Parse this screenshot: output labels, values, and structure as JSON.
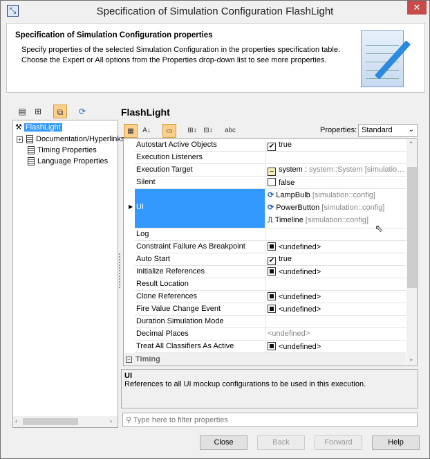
{
  "window": {
    "title": "Specification of Simulation Configuration FlashLight",
    "close": "✕"
  },
  "header": {
    "title": "Specification of Simulation Configuration properties",
    "desc_line1": "Specify properties of the selected Simulation Configuration in the properties specification table.",
    "desc_line2": "Choose the Expert or All options from the Properties drop-down list to see more properties."
  },
  "tree": {
    "root": "FlashLight",
    "items": [
      "Documentation/Hyperlinks",
      "Timing Properties",
      "Language Properties"
    ]
  },
  "panel": {
    "title": "FlashLight",
    "properties_label": "Properties:",
    "properties_value": "Standard"
  },
  "rows": [
    {
      "name": "Autostart Active Objects",
      "value": "true"
    },
    {
      "name": "Execution Listeners",
      "value": ""
    },
    {
      "name": "Execution Target",
      "value": "system :",
      "value_gray": " system::System [simulatio…"
    },
    {
      "name": "Silent",
      "value": "false"
    },
    {
      "name": "UI",
      "items": [
        {
          "name": "LampBulb",
          "qual": " [simulation::config]"
        },
        {
          "name": "PowerButton",
          "qual": " [simulation::config]"
        },
        {
          "name": "Timeline",
          "qual": " [simulation::config]"
        }
      ]
    },
    {
      "name": "Log",
      "value": ""
    },
    {
      "name": "Constraint Failure As Breakpoint",
      "value": "<undefined>"
    },
    {
      "name": "Auto Start",
      "value": "true"
    },
    {
      "name": "Initialize References",
      "value": "<undefined>"
    },
    {
      "name": "Result Location",
      "value": ""
    },
    {
      "name": "Clone References",
      "value": "<undefined>"
    },
    {
      "name": "Fire Value Change Event",
      "value": "<undefined>"
    },
    {
      "name": "Duration Simulation Mode",
      "value": ""
    },
    {
      "name": "Decimal Places",
      "value": "<undefined>"
    },
    {
      "name": "Treat All Classifiers As Active",
      "value": "<undefined>"
    }
  ],
  "group": "Timing",
  "description": {
    "title": "UI",
    "text": "References to all UI mockup configurations to be used in this execution."
  },
  "filter": {
    "placeholder": "Type here to filter properties"
  },
  "buttons": {
    "close": "Close",
    "back": "Back",
    "forward": "Forward",
    "help": "Help"
  }
}
